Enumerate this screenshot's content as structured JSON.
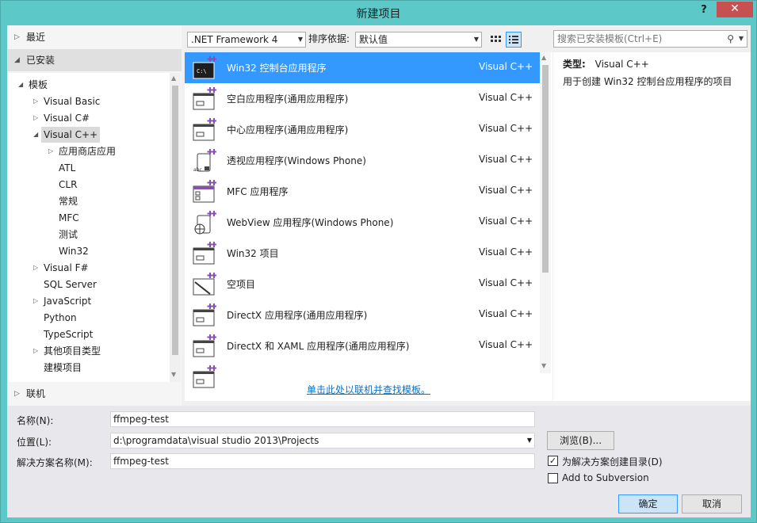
{
  "window": {
    "title": "新建项目",
    "help": "?",
    "close": "✕"
  },
  "left": {
    "recent": "最近",
    "installed": "已安装",
    "online": "联机",
    "tree": [
      {
        "label": "模板",
        "arrow": "◢",
        "level": 0
      },
      {
        "label": "Visual Basic",
        "arrow": "▷",
        "level": 1
      },
      {
        "label": "Visual C#",
        "arrow": "▷",
        "level": 1
      },
      {
        "label": "Visual C++",
        "arrow": "◢",
        "level": 1,
        "selected": true
      },
      {
        "label": "应用商店应用",
        "arrow": "▷",
        "level": 2
      },
      {
        "label": "ATL",
        "arrow": "",
        "level": 2
      },
      {
        "label": "CLR",
        "arrow": "",
        "level": 2
      },
      {
        "label": "常规",
        "arrow": "",
        "level": 2
      },
      {
        "label": "MFC",
        "arrow": "",
        "level": 2
      },
      {
        "label": "测试",
        "arrow": "",
        "level": 2
      },
      {
        "label": "Win32",
        "arrow": "",
        "level": 2
      },
      {
        "label": "Visual F#",
        "arrow": "▷",
        "level": 1
      },
      {
        "label": "SQL Server",
        "arrow": "",
        "level": 1
      },
      {
        "label": "JavaScript",
        "arrow": "▷",
        "level": 1
      },
      {
        "label": "Python",
        "arrow": "",
        "level": 1
      },
      {
        "label": "TypeScript",
        "arrow": "",
        "level": 1
      },
      {
        "label": "其他项目类型",
        "arrow": "▷",
        "level": 1
      },
      {
        "label": "建模项目",
        "arrow": "",
        "level": 1
      }
    ]
  },
  "toolbar": {
    "framework": ".NET Framework 4",
    "sort_label": "排序依据:",
    "sort_value": "默认值"
  },
  "templates": [
    {
      "name": "Win32 控制台应用程序",
      "lang": "Visual C++",
      "icon": "console-icon",
      "selected": true
    },
    {
      "name": "空白应用程序(通用应用程序)",
      "lang": "Visual C++",
      "icon": "blank-app-icon"
    },
    {
      "name": "中心应用程序(通用应用程序)",
      "lang": "Visual C++",
      "icon": "hub-app-icon"
    },
    {
      "name": "透视应用程序(Windows Phone)",
      "lang": "Visual C++",
      "icon": "pivot-app-icon"
    },
    {
      "name": "MFC 应用程序",
      "lang": "Visual C++",
      "icon": "mfc-app-icon"
    },
    {
      "name": "WebView 应用程序(Windows Phone)",
      "lang": "Visual C++",
      "icon": "webview-app-icon"
    },
    {
      "name": "Win32 项目",
      "lang": "Visual C++",
      "icon": "win32-project-icon"
    },
    {
      "name": "空项目",
      "lang": "Visual C++",
      "icon": "empty-project-icon"
    },
    {
      "name": "DirectX 应用程序(通用应用程序)",
      "lang": "Visual C++",
      "icon": "directx-app-icon"
    },
    {
      "name": "DirectX 和 XAML 应用程序(通用应用程序)",
      "lang": "Visual C++",
      "icon": "directx-xaml-app-icon"
    }
  ],
  "online_link": "单击此处以联机并查找模板。",
  "search": {
    "placeholder": "搜索已安装模板(Ctrl+E)"
  },
  "description": {
    "type_label": "类型:",
    "type_value": "Visual C++",
    "text": "用于创建 Win32 控制台应用程序的项目"
  },
  "form": {
    "name_label": "名称(N):",
    "name_value": "ffmpeg-test",
    "location_label": "位置(L):",
    "location_value": "d:\\programdata\\visual studio 2013\\Projects",
    "solution_label": "解决方案名称(M):",
    "solution_value": "ffmpeg-test",
    "browse": "浏览(B)...",
    "create_dir": "为解决方案创建目录(D)",
    "create_dir_checked": true,
    "subversion": "Add to Subversion",
    "subversion_checked": false,
    "ok": "确定",
    "cancel": "取消"
  }
}
